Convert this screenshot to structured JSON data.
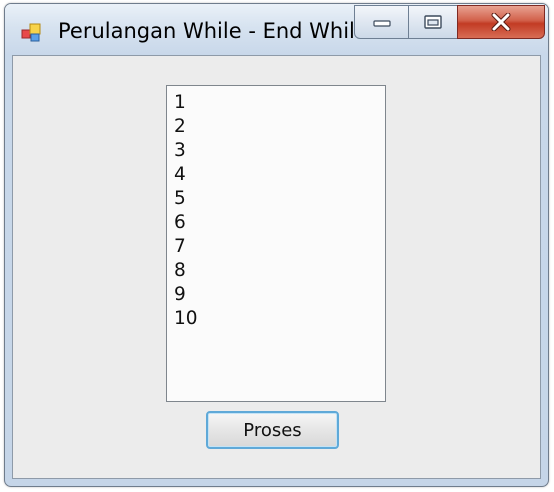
{
  "window": {
    "title": "Perulangan While - End While"
  },
  "titlebar_buttons": {
    "minimize_icon": "minimize-icon",
    "maximize_icon": "restore-icon",
    "close_icon": "close-icon"
  },
  "listbox": {
    "items": [
      "1",
      "2",
      "3",
      "4",
      "5",
      "6",
      "7",
      "8",
      "9",
      "10"
    ]
  },
  "proses_button": {
    "label": "Proses"
  },
  "colors": {
    "close_button": "#c94a33",
    "button_focus_border": "#5fa9d8",
    "client_background": "#ececec"
  }
}
